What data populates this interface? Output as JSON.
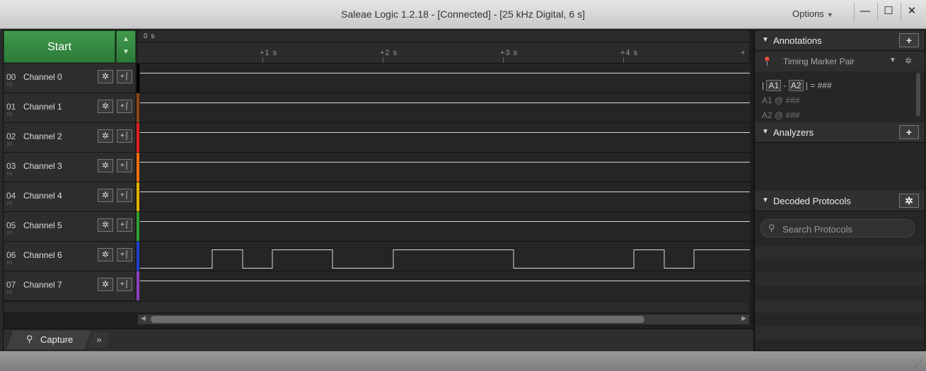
{
  "window": {
    "title": "Saleae Logic 1.2.18 - [Connected] - [25 kHz Digital, 6 s]",
    "options_label": "Options",
    "minimize": "—",
    "maximize": "☐",
    "close": "✕"
  },
  "capture": {
    "start_label": "Start",
    "ruler_origin": "0 s",
    "ticks": [
      "+1 s",
      "+2 s",
      "+3 s",
      "+4 s",
      "+"
    ]
  },
  "channels": [
    {
      "num": "00",
      "name": "Channel 0",
      "color": "#000000"
    },
    {
      "num": "01",
      "name": "Channel 1",
      "color": "#8b4513"
    },
    {
      "num": "02",
      "name": "Channel 2",
      "color": "#e02020"
    },
    {
      "num": "03",
      "name": "Channel 3",
      "color": "#f07010"
    },
    {
      "num": "04",
      "name": "Channel 4",
      "color": "#e0b000"
    },
    {
      "num": "05",
      "name": "Channel 5",
      "color": "#30a030"
    },
    {
      "num": "06",
      "name": "Channel 6",
      "color": "#2040d0"
    },
    {
      "num": "07",
      "name": "Channel 7",
      "color": "#9040c0"
    }
  ],
  "tabs": {
    "capture_label": "Capture",
    "more": "»"
  },
  "annotations": {
    "title": "Annotations",
    "add": "+",
    "timing_marker": "Timing Marker Pair",
    "formula_a1": "A1",
    "formula_a2": "A2",
    "formula_value": "= ###",
    "a1_row": "A1  @  ###",
    "a2_row": "A2  @  ###"
  },
  "analyzers": {
    "title": "Analyzers",
    "add": "+"
  },
  "decoded": {
    "title": "Decoded Protocols",
    "search_placeholder": "Search Protocols"
  }
}
